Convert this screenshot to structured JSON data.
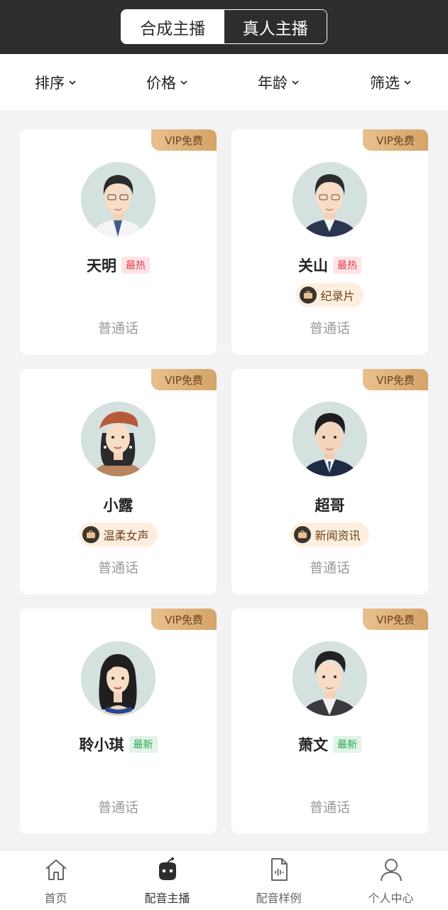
{
  "header": {
    "tabs": [
      {
        "label": "合成主播",
        "active": true
      },
      {
        "label": "真人主播",
        "active": false
      }
    ]
  },
  "filters": [
    {
      "label": "排序"
    },
    {
      "label": "价格"
    },
    {
      "label": "年龄"
    },
    {
      "label": "筛选"
    }
  ],
  "anchors": [
    {
      "name": "天明",
      "vip": "VIP免费",
      "badge": "最热",
      "badge_type": "hot",
      "tag": "",
      "lang": "普通话",
      "avatar": "male-glasses-portrait"
    },
    {
      "name": "关山",
      "vip": "VIP免费",
      "badge": "最热",
      "badge_type": "hot",
      "tag": "纪录片",
      "lang": "普通话",
      "avatar": "male-glasses-suit-portrait"
    },
    {
      "name": "小露",
      "vip": "VIP免费",
      "badge": "",
      "badge_type": "",
      "tag": "温柔女声",
      "lang": "普通话",
      "avatar": "female-beret-portrait"
    },
    {
      "name": "超哥",
      "vip": "VIP免费",
      "badge": "",
      "badge_type": "",
      "tag": "新闻资讯",
      "lang": "普通话",
      "avatar": "male-suit-portrait"
    },
    {
      "name": "聆小琪",
      "vip": "VIP免费",
      "badge": "最新",
      "badge_type": "new",
      "tag": "",
      "lang": "普通话",
      "avatar": "female-longhair-portrait"
    },
    {
      "name": "萧文",
      "vip": "VIP免费",
      "badge": "最新",
      "badge_type": "new",
      "tag": "",
      "lang": "普通话",
      "avatar": "male-jacket-portrait"
    }
  ],
  "bottom_nav": [
    {
      "label": "首页",
      "icon": "home-icon",
      "active": false
    },
    {
      "label": "配音主播",
      "icon": "robot-icon",
      "active": true
    },
    {
      "label": "配音样例",
      "icon": "audio-file-icon",
      "active": false
    },
    {
      "label": "个人中心",
      "icon": "user-icon",
      "active": false
    }
  ],
  "colors": {
    "header_bg": "#2d2d2d",
    "vip_gold": "#d4a468",
    "hot_red": "#e0404f",
    "new_green": "#28a852"
  }
}
